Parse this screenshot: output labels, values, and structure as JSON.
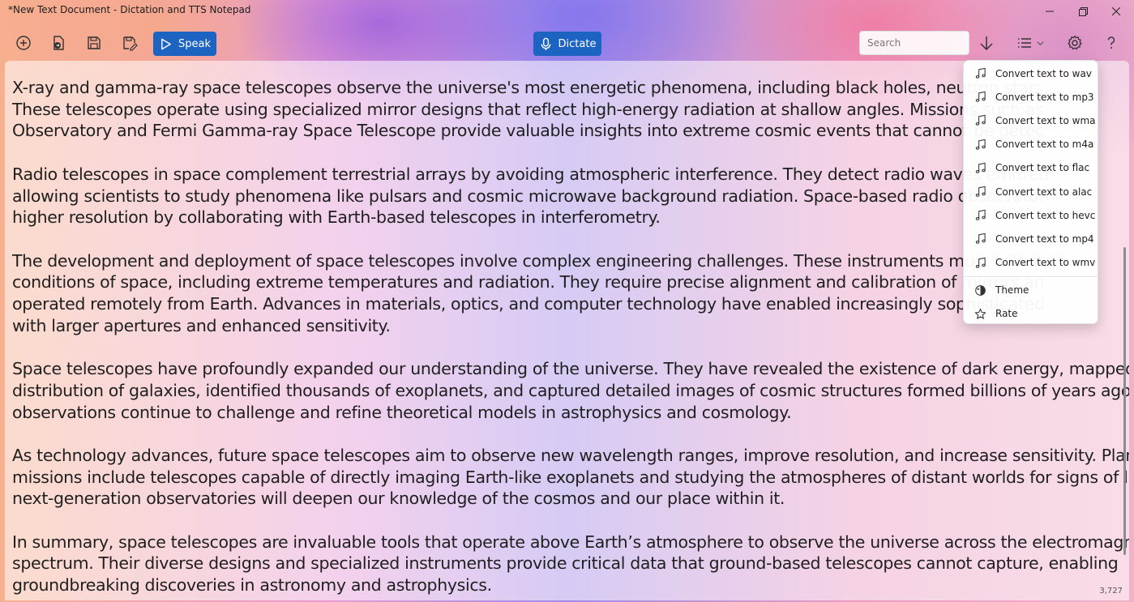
{
  "window": {
    "title": "*New Text Document - Dictation and TTS Notepad",
    "minimize_icon": "minimize-icon",
    "maximize_icon": "maximize-icon",
    "close_icon": "close-icon"
  },
  "toolbar": {
    "speak_label": "Speak",
    "dictate_label": "Dictate",
    "search_placeholder": "Search",
    "accent": "#1d64c2"
  },
  "document": {
    "paragraphs": [
      [
        "X-ray and gamma-ray space telescopes observe the universe's most energetic phenomena, including black holes, neutron stars,",
        "These telescopes operate using specialized mirror designs that reflect high-energy radiation at shallow angles. Missions such as",
        "Observatory and Fermi Gamma-ray Space Telescope provide valuable insights into extreme cosmic events that cannot be detec"
      ],
      [
        "Radio telescopes in space complement terrestrial arrays by avoiding atmospheric interference. They detect radio waves emitted",
        "allowing scientists to study phenomena like pulsars and cosmic microwave background radiation. Space-based radio observator",
        "higher resolution by collaborating with Earth-based telescopes in interferometry."
      ],
      [
        "The development and deployment of space telescopes involve complex engineering challenges. These instruments must withsta",
        "conditions of space, including extreme temperatures and radiation. They require precise alignment and calibration of mirrors an",
        "operated remotely from Earth. Advances in materials, optics, and computer technology have enabled increasingly sophisticated",
        "with larger apertures and enhanced sensitivity."
      ],
      [
        "Space telescopes have profoundly expanded our understanding of the universe. They have revealed the existence of dark energy, mapped the",
        "distribution of galaxies, identified thousands of exoplanets, and captured detailed images of cosmic structures formed billions of years ago. Their",
        "observations continue to challenge and refine theoretical models in astrophysics and cosmology."
      ],
      [
        "As technology advances, future space telescopes aim to observe new wavelength ranges, improve resolution, and increase sensitivity. Planned",
        "missions include telescopes capable of directly imaging Earth-like exoplanets and studying the atmospheres of distant worlds for signs of life. These",
        "next-generation observatories will deepen our knowledge of the cosmos and our place within it."
      ],
      [
        "In summary, space telescopes are invaluable tools that operate above Earth’s atmosphere to observe the universe across the electromagnetic",
        "spectrum. Their diverse designs and specialized instruments provide critical data that ground-based telescopes cannot capture, enabling",
        "groundbreaking discoveries in astronomy and astrophysics."
      ]
    ],
    "char_count": "3,727"
  },
  "menu": {
    "convert_items": [
      {
        "label": "Convert text to wav",
        "icon": "music-note-icon"
      },
      {
        "label": "Convert text to mp3",
        "icon": "music-note-icon"
      },
      {
        "label": "Convert text to wma",
        "icon": "music-note-icon"
      },
      {
        "label": "Convert text to m4a",
        "icon": "music-note-icon"
      },
      {
        "label": "Convert text to flac",
        "icon": "music-note-icon"
      },
      {
        "label": "Convert text to alac",
        "icon": "music-note-icon"
      },
      {
        "label": "Convert text to hevc",
        "icon": "music-note-icon"
      },
      {
        "label": "Convert text to mp4",
        "icon": "music-note-icon"
      },
      {
        "label": "Convert text to wmv",
        "icon": "music-note-icon"
      }
    ],
    "theme_label": "Theme",
    "rate_label": "Rate"
  }
}
